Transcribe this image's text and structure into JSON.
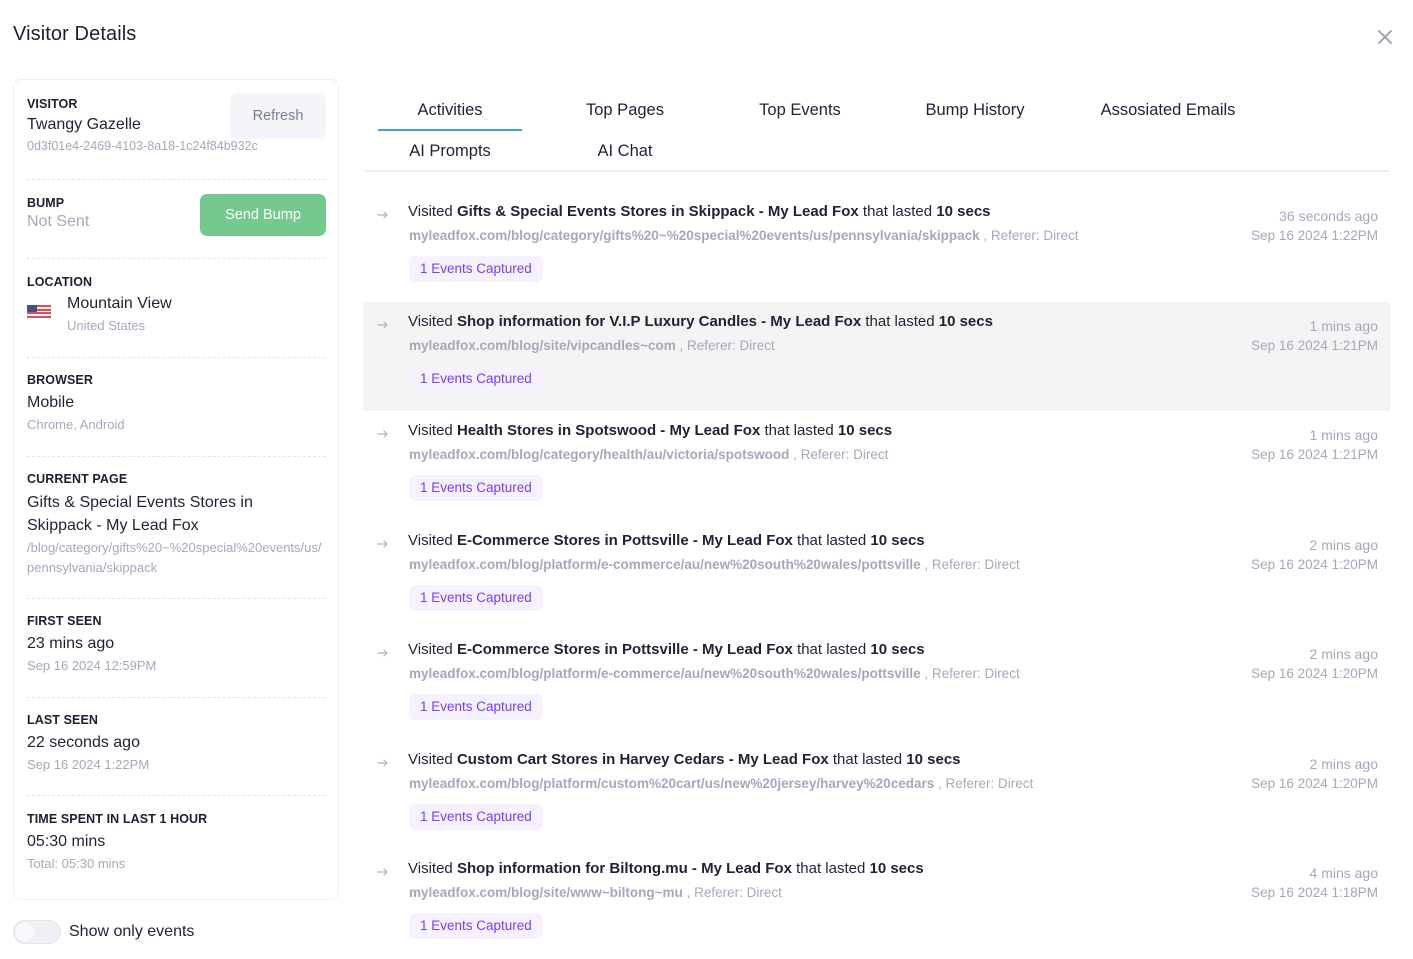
{
  "modal": {
    "title": "Visitor Details",
    "close_icon": "close-icon"
  },
  "visitor": {
    "label": "VISITOR",
    "name": "Twangy Gazelle",
    "id": "0d3f01e4-2469-4103-8a18-1c24f84b932c",
    "refresh_label": "Refresh"
  },
  "bump": {
    "label": "BUMP",
    "status": "Not Sent",
    "send_label": "Send Bump",
    "send_color": "#76c98e"
  },
  "location": {
    "label": "LOCATION",
    "city": "Mountain View",
    "country": "United States",
    "flag_icon": "us-flag-icon"
  },
  "browser": {
    "label": "BROWSER",
    "device": "Mobile",
    "detail": "Chrome, Android"
  },
  "current_page": {
    "label": "CURRENT PAGE",
    "title": "Gifts & Special Events Stores in Skippack - My Lead Fox",
    "path": "/blog/category/gifts%20~%20special%20events/us/pennsylvania/skippack"
  },
  "first_seen": {
    "label": "FIRST SEEN",
    "relative": "23 mins ago",
    "absolute": "Sep 16 2024 12:59PM"
  },
  "last_seen": {
    "label": "LAST SEEN",
    "relative": "22 seconds ago",
    "absolute": "Sep 16 2024 1:22PM"
  },
  "time_spent": {
    "label": "TIME SPENT IN LAST 1 HOUR",
    "value": "05:30 mins",
    "total": "Total: 05:30 mins"
  },
  "toggle": {
    "label": "Show only events",
    "checked": false
  },
  "tabs": [
    {
      "label": "Activities",
      "active": true
    },
    {
      "label": "Top Pages",
      "active": false
    },
    {
      "label": "Top Events",
      "active": false
    },
    {
      "label": "Bump History",
      "active": false
    },
    {
      "label": "Assosiated Emails",
      "active": false
    },
    {
      "label": "AI Prompts",
      "active": false
    },
    {
      "label": "AI Chat",
      "active": false
    }
  ],
  "activities": [
    {
      "prefix": "Visited",
      "page": "Gifts & Special Events Stores in Skippack - My Lead Fox",
      "middle": "that lasted",
      "duration": "10 secs",
      "url": "myleadfox.com/blog/category/gifts%20~%20special%20events/us/pennsylvania/skippack",
      "referer": ", Referer: Direct",
      "badge": "1 Events Captured",
      "relative": "36 seconds ago",
      "absolute": "Sep 16 2024 1:22PM"
    },
    {
      "prefix": "Visited",
      "page": "Shop information for V.I.P Luxury Candles - My Lead Fox",
      "middle": "that lasted",
      "duration": "10 secs",
      "url": "myleadfox.com/blog/site/vipcandles~com",
      "referer": ", Referer: Direct",
      "badge": "1 Events Captured",
      "relative": "1 mins ago",
      "absolute": "Sep 16 2024 1:21PM"
    },
    {
      "prefix": "Visited",
      "page": "Health Stores in Spotswood - My Lead Fox",
      "middle": "that lasted",
      "duration": "10 secs",
      "url": "myleadfox.com/blog/category/health/au/victoria/spotswood",
      "referer": ", Referer: Direct",
      "badge": "1 Events Captured",
      "relative": "1 mins ago",
      "absolute": "Sep 16 2024 1:21PM"
    },
    {
      "prefix": "Visited",
      "page": "E-Commerce Stores in Pottsville - My Lead Fox",
      "middle": "that lasted",
      "duration": "10 secs",
      "url": "myleadfox.com/blog/platform/e-commerce/au/new%20south%20wales/pottsville",
      "referer": ", Referer: Direct",
      "badge": "1 Events Captured",
      "relative": "2 mins ago",
      "absolute": "Sep 16 2024 1:20PM"
    },
    {
      "prefix": "Visited",
      "page": "E-Commerce Stores in Pottsville - My Lead Fox",
      "middle": "that lasted",
      "duration": "10 secs",
      "url": "myleadfox.com/blog/platform/e-commerce/au/new%20south%20wales/pottsville",
      "referer": ", Referer: Direct",
      "badge": "1 Events Captured",
      "relative": "2 mins ago",
      "absolute": "Sep 16 2024 1:20PM"
    },
    {
      "prefix": "Visited",
      "page": "Custom Cart Stores in Harvey Cedars - My Lead Fox",
      "middle": "that lasted",
      "duration": "10 secs",
      "url": "myleadfox.com/blog/platform/custom%20cart/us/new%20jersey/harvey%20cedars",
      "referer": ", Referer: Direct",
      "badge": "1 Events Captured",
      "relative": "2 mins ago",
      "absolute": "Sep 16 2024 1:20PM"
    },
    {
      "prefix": "Visited",
      "page": "Shop information for Biltong.mu - My Lead Fox",
      "middle": "that lasted",
      "duration": "10 secs",
      "url": "myleadfox.com/blog/site/www~biltong~mu",
      "referer": ", Referer: Direct",
      "badge": "1 Events Captured",
      "relative": "4 mins ago",
      "absolute": "Sep 16 2024 1:18PM"
    }
  ],
  "colors": {
    "tab_active": "#4a9ae0",
    "badge_text": "#7b3fe4",
    "badge_bg": "#f5f1fe",
    "muted_text": "#a6a8ba",
    "row_highlight": "#f4f4f5"
  }
}
